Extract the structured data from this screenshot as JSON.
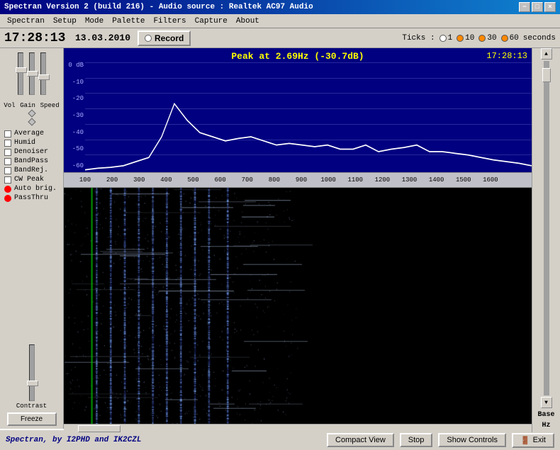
{
  "window": {
    "title": "Spectran Version 2 (build 216) - Audio source : Realtek AC97 Audio",
    "minimize": "−",
    "maximize": "□",
    "close": "×"
  },
  "menu": {
    "items": [
      "Spectran",
      "Setup",
      "Mode",
      "Palette",
      "Filters",
      "Capture",
      "About"
    ]
  },
  "toolbar": {
    "clock": "17:28:13",
    "date": "13.03.2010",
    "record_label": "Record",
    "ticks_label": "Ticks :",
    "tick_options": [
      "1",
      "10",
      "30",
      "60"
    ],
    "tick_selected": "60",
    "seconds_label": "seconds"
  },
  "spectrum": {
    "peak_text": "Peak at   2.69Hz (-30.7dB)",
    "time": "17:28:13",
    "db_labels": [
      "-10",
      "-20",
      "-30",
      "-40",
      "-50",
      "-60"
    ],
    "db_top": "0 dB"
  },
  "freq_axis": {
    "ticks": [
      "100",
      "200",
      "300",
      "400",
      "500",
      "600",
      "700",
      "800",
      "900",
      "1000",
      "1100",
      "1200",
      "1300",
      "1400",
      "1500",
      "1600"
    ]
  },
  "sidebar": {
    "vol_label": "Vol",
    "gain_label": "Gain",
    "speed_label": "Speed",
    "base_label": "Base",
    "hz_label": "Hz",
    "filters": [
      {
        "name": "Average",
        "type": "check"
      },
      {
        "name": "Humid",
        "type": "check"
      },
      {
        "name": "Denoiser",
        "type": "check"
      },
      {
        "name": "BandPass",
        "type": "check"
      },
      {
        "name": "BandRej.",
        "type": "check"
      },
      {
        "name": "CW Peak",
        "type": "check"
      },
      {
        "name": "Auto brig.",
        "type": "red"
      },
      {
        "name": "PassThru",
        "type": "red"
      }
    ],
    "contrast_label": "Contrast",
    "freeze_label": "Freeze"
  },
  "statusbar": {
    "text": "Spectran, by I2PHD and IK2CZL",
    "compact_view": "Compact View",
    "stop": "Stop",
    "show_controls": "Show Controls",
    "exit": "Exit"
  }
}
